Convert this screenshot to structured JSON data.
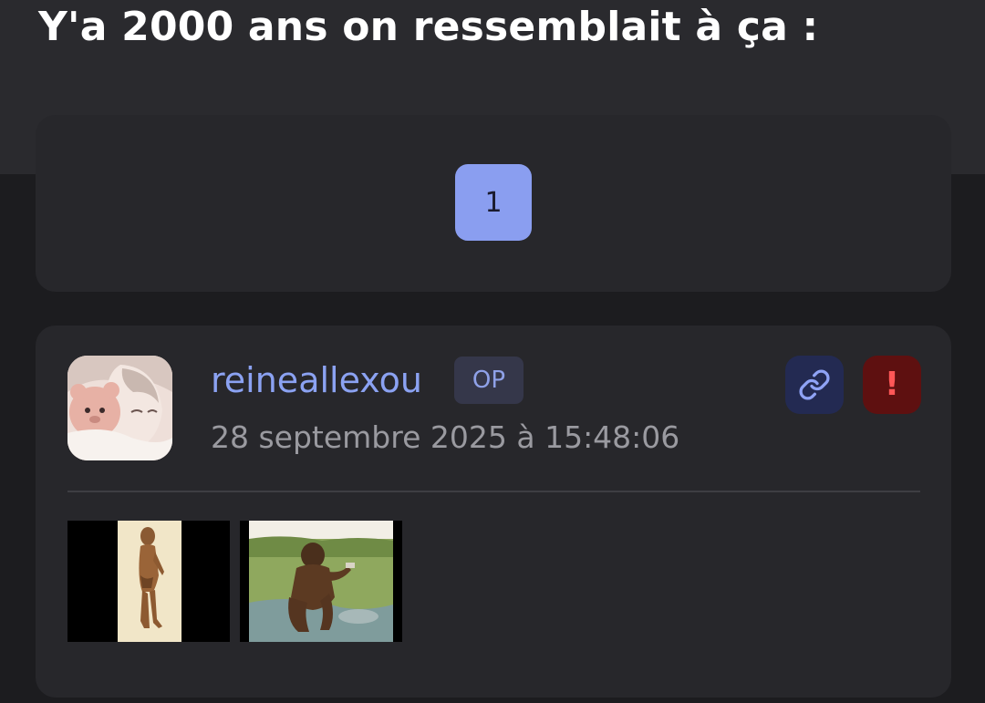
{
  "topic": {
    "title": "Y'a 2000 ans on ressemblait à ça :"
  },
  "pagination": {
    "current_page": "1"
  },
  "post": {
    "author": "reineallexou",
    "badge": "OP",
    "date": "28 septembre 2025 à 15:48:06",
    "actions": {
      "link_icon": "link-icon",
      "report_icon": "exclamation-icon",
      "report_symbol": "!"
    },
    "attachments": [
      {
        "kind": "image-thumbnail",
        "subject": "early-hominid-standing"
      },
      {
        "kind": "image-thumbnail",
        "subject": "early-human-crouching-landscape"
      }
    ]
  },
  "colors": {
    "accent": "#8a9ef0",
    "author": "#8ba2f2",
    "background": "#1c1c1f",
    "card": "#27272b",
    "report_bg": "#5e1010",
    "report_fg": "#ff5757"
  }
}
